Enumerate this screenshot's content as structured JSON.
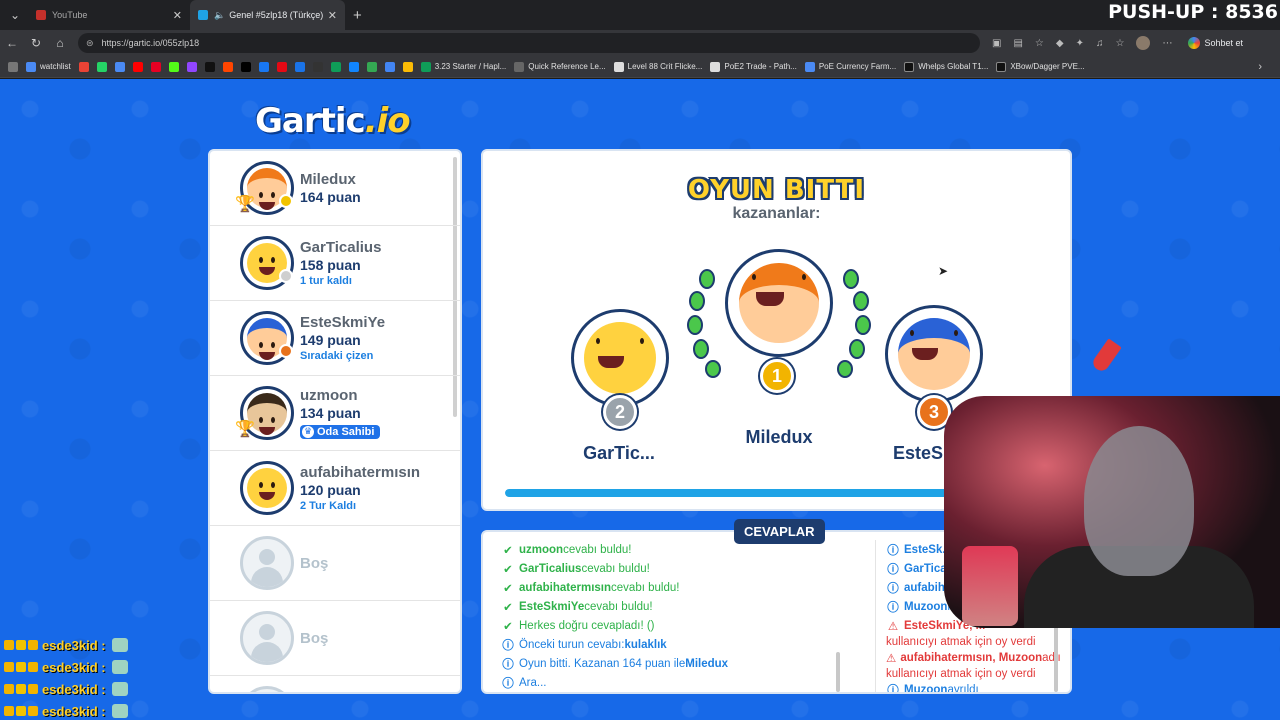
{
  "browser": {
    "tabs": [
      {
        "title": "YouTube",
        "active": false
      },
      {
        "title": "Genel #5zlp18 (Türkçe) - Gartic",
        "active": true
      }
    ],
    "url": "https://gartic.io/055zlp18",
    "sohbet_label": "Sohbet et",
    "bookmarks": [
      "watchlist",
      "3.23 Starter / Hapl...",
      "Quick Reference Le...",
      "Level 88 Crit Flicke...",
      "PoE2 Trade - Path...",
      "PoE Currency Farm...",
      "Whelps Global T1...",
      "XBow/Dagger PVE..."
    ]
  },
  "overlay": {
    "pushup_counter": "PUSH-UP : 8536",
    "chat_user": "esde3kid :"
  },
  "game": {
    "logo_main": "Gartic",
    "logo_suffix": ".io",
    "players": [
      {
        "name": "Miledux",
        "score": "164 puan",
        "sub": "",
        "trophy": true,
        "status": "#f2c300"
      },
      {
        "name": "GarTicalius",
        "score": "158 puan",
        "sub": "1 tur kaldı",
        "trophy": false,
        "status": "#cfcfcf"
      },
      {
        "name": "EsteSkmiYe",
        "score": "149 puan",
        "sub": "Sıradaki çizen",
        "trophy": false,
        "status": "#e8721c"
      },
      {
        "name": "uzmoon",
        "score": "134 puan",
        "sub": "",
        "host_badge": "Oda Sahibi",
        "trophy": true
      },
      {
        "name": "aufabihatermısın",
        "score": "120 puan",
        "sub": "2 Tur Kaldı",
        "trophy": false
      }
    ],
    "empty_slot_label": "Boş",
    "result": {
      "title": "OYUN BITTI",
      "subtitle": "kazananlar:",
      "first": {
        "name": "Miledux",
        "rank": "1"
      },
      "second": {
        "name": "GarTic...",
        "rank": "2"
      },
      "third": {
        "name": "EsteSk",
        "rank": "3"
      },
      "progress": 0.86
    },
    "answers_tab": "CEVAPLAR",
    "answers": [
      {
        "type": "ok",
        "user": "uzmoon",
        "text": " cevabı buldu!"
      },
      {
        "type": "ok",
        "user": "GarTicalius",
        "text": " cevabı buldu!"
      },
      {
        "type": "ok",
        "user": "aufabihatermısın",
        "text": " cevabı buldu!"
      },
      {
        "type": "ok",
        "user": "EsteSkmiYe",
        "text": " cevabı buldu!"
      },
      {
        "type": "ok",
        "user": "",
        "text": "Herkes doğru cevapladı! ()"
      },
      {
        "type": "info",
        "user": "",
        "text": "Önceki turun cevabı: ",
        "extra": "kulaklık"
      },
      {
        "type": "info",
        "user": "",
        "text": "Oyun bitti. Kazanan 164 puan ile ",
        "extra": "Miledux"
      },
      {
        "type": "info",
        "user": "",
        "text": "Ara..."
      }
    ],
    "chat": [
      {
        "type": "info",
        "user": "EsteSk...",
        "text": ""
      },
      {
        "type": "info",
        "user": "GarTicaliu",
        "text": ""
      },
      {
        "type": "info",
        "user": "aufabihate",
        "text": ""
      },
      {
        "type": "info",
        "user": "Muzoon",
        "text": " ka"
      },
      {
        "type": "warn",
        "user": "EsteSkmiYe, M",
        "text": ""
      },
      {
        "type": "warn",
        "user": "",
        "text": "kullanıcıyı atmak için oy verdi"
      },
      {
        "type": "warn",
        "user": "aufabihatermısın, Muzoon",
        "text": " adlı"
      },
      {
        "type": "warn",
        "user": "",
        "text": "kullanıcıyı atmak için oy verdi"
      },
      {
        "type": "info",
        "user": "Muzoon",
        "text": " ayrıldı"
      }
    ]
  }
}
